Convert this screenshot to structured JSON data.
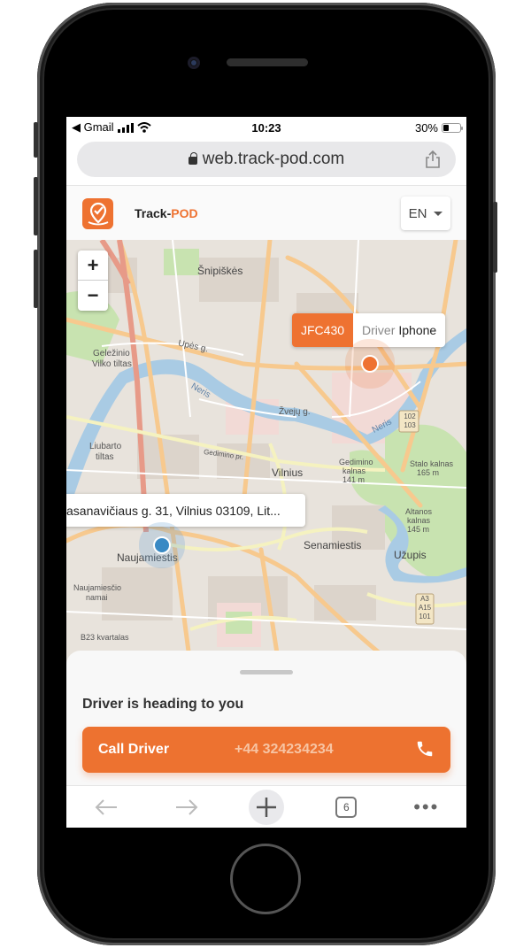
{
  "device": {
    "model": "iPhone"
  },
  "statusbar": {
    "back_app": "◀ Gmail",
    "time": "10:23",
    "battery": "30%"
  },
  "browser": {
    "url": "web.track-pod.com",
    "toolbar": {
      "back": "back",
      "forward": "forward",
      "new_tab": "new-tab",
      "tab_count": "6",
      "more": "•••"
    }
  },
  "header": {
    "brand_prefix": "Track-",
    "brand_suffix": "POD",
    "language": "EN",
    "accent_color": "#ee7231"
  },
  "map": {
    "zoom_in": "+",
    "zoom_out": "−",
    "driver": {
      "plate": "JFC430",
      "label": "Driver",
      "name": "Iphone"
    },
    "destination_address": "asanavičiaus g. 31, Vilnius 03109, Lit...",
    "labels": {
      "snipiskes": "Šnipiškės",
      "vilnius": "Vilnius",
      "naujamiestis": "Naujamiestis",
      "senamiestis": "Senamiestis",
      "uzupis": "Užupis",
      "gelezinio": "Geležinio",
      "vilko_tiltas": "Vilko tiltas",
      "liubarto": "Liubarto",
      "tiltas": "tiltas",
      "gedimino_pr": "Gedimino pr.",
      "gedimino_kalnas": "Gedimino",
      "kalnas": "kalnas",
      "gedimino_h": "141 m",
      "stalo": "Stalo kalnas",
      "stalo_h": "165 m",
      "altanos": "Altanos",
      "altanos_k": "kalnas",
      "altanos_h": "145 m",
      "naujamiescio": "Naujamiesčio",
      "namai": "namai",
      "b23": "B23 kvartalas",
      "upes": "Upės g.",
      "zveju": "Žvejų g.",
      "neris": "Neris",
      "shield1": "102\n103",
      "shield2": "A3\nA15\n101"
    }
  },
  "sheet": {
    "title": "Driver is heading to you",
    "call_label": "Call Driver",
    "phone_number": "+44 324234234"
  }
}
